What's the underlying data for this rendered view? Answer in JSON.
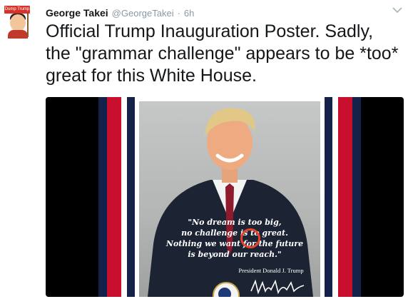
{
  "tweet": {
    "author_name": "George Takei",
    "author_handle": "@GeorgeTakei",
    "separator": "·",
    "timestamp": "6h",
    "text": "Official Trump Inauguration Poster. Sadly, the \"grammar challenge\" appears to be *too* great for this White House.",
    "avatar_sign_text": "Dump Trump"
  },
  "poster": {
    "quote_lines": [
      "\"No dream is too big,",
      "no challenge is to great.",
      "Nothing we want for the future",
      "is beyond our reach.\""
    ],
    "attribution": "President Donald J. Trump"
  },
  "colors": {
    "text_primary": "#14171a",
    "text_secondary": "#8899a6",
    "stripe_red": "#c8102e",
    "stripe_navy": "#14224a",
    "circle": "#e8442d"
  },
  "icons": [
    "avatar",
    "caret-down-icon",
    "presidential-seal-icon",
    "signature"
  ]
}
